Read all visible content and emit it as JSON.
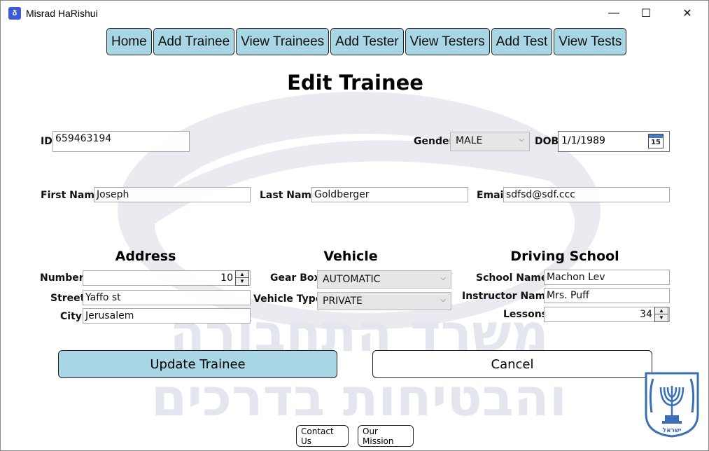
{
  "window": {
    "title": "Misrad HaRishui",
    "controls": {
      "minimize": "—",
      "maximize": "☐",
      "close": "✕"
    }
  },
  "nav": {
    "items": [
      "Home",
      "Add Trainee",
      "View Trainees",
      "Add Tester",
      "View Testers",
      "Add Test",
      "View Tests"
    ]
  },
  "page": {
    "title": "Edit Trainee"
  },
  "form": {
    "id": {
      "label": "ID",
      "value": "659463194"
    },
    "gender": {
      "label": "Gender",
      "value": "MALE"
    },
    "dob": {
      "label": "DOB",
      "value": "1/1/1989",
      "calendar_day": "15"
    },
    "first_name": {
      "label": "First Name",
      "value": "Joseph"
    },
    "last_name": {
      "label": "Last Name",
      "value": "Goldberger"
    },
    "email": {
      "label": "Email",
      "value": "sdfsd@sdf.ccc"
    }
  },
  "address": {
    "title": "Address",
    "number": {
      "label": "Number",
      "value": "10"
    },
    "street": {
      "label": "Street",
      "value": "Yaffo st"
    },
    "city": {
      "label": "City",
      "value": "Jerusalem"
    }
  },
  "vehicle": {
    "title": "Vehicle",
    "gear_box": {
      "label": "Gear Box",
      "value": "AUTOMATIC"
    },
    "vehicle_type": {
      "label": "Vehicle Type",
      "value": "PRIVATE"
    }
  },
  "school": {
    "title": "Driving School",
    "school_name": {
      "label": "School Name",
      "value": "Machon Lev"
    },
    "instructor": {
      "label": "Instructor Name",
      "value": "Mrs. Puff"
    },
    "lessons": {
      "label": "Lessons",
      "value": "34"
    }
  },
  "actions": {
    "update": "Update Trainee",
    "cancel": "Cancel"
  },
  "footer": {
    "contact": "Contact Us",
    "mission": "Our Mission"
  },
  "watermark": {
    "line1": "משרד התחבורה",
    "line2": "והבטיחות בדרכים",
    "emblem_text": "ישראל"
  },
  "colors": {
    "accent": "#a9d6e5",
    "watermark": "#e3e6ee",
    "icon_blue": "#3b5bd6"
  }
}
